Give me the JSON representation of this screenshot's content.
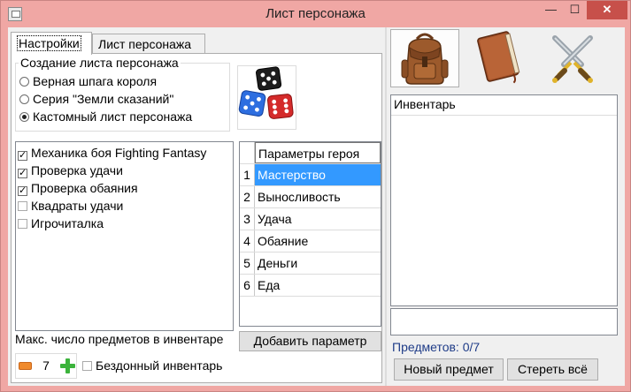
{
  "window": {
    "title": "Лист персонажа",
    "minimize_glyph": "—",
    "maximize_glyph": "☐",
    "close_glyph": "✕",
    "accent_color": "#f0a7a4",
    "close_color": "#c7504a"
  },
  "tabs": [
    {
      "label": "Настройки",
      "active": true
    },
    {
      "label": "Лист персонажа",
      "active": false
    }
  ],
  "creation": {
    "title": "Создание листа персонажа",
    "options": [
      {
        "label": "Верная шпага короля",
        "checked": false
      },
      {
        "label": "Серия \"Земли сказаний\"",
        "checked": false
      },
      {
        "label": "Кастомный лист персонажа",
        "checked": true
      }
    ],
    "image_icon": "dice-icon"
  },
  "mechanics": [
    {
      "label": "Механика боя Fighting Fantasy",
      "checked": true
    },
    {
      "label": "Проверка удачи",
      "checked": true
    },
    {
      "label": "Проверка обаяния",
      "checked": true
    },
    {
      "label": "Квадраты удачи",
      "checked": false
    },
    {
      "label": "Игрочиталка",
      "checked": false
    }
  ],
  "params_grid": {
    "header": "Параметры героя",
    "rows": [
      {
        "num": "1",
        "name": "Мастерство",
        "selected": true
      },
      {
        "num": "2",
        "name": "Выносливость",
        "selected": false
      },
      {
        "num": "3",
        "name": "Удача",
        "selected": false
      },
      {
        "num": "4",
        "name": "Обаяние",
        "selected": false
      },
      {
        "num": "5",
        "name": "Деньги",
        "selected": false
      },
      {
        "num": "6",
        "name": "Еда",
        "selected": false
      }
    ],
    "selection_color": "#3399ff"
  },
  "add_param_label": "Добавить параметр",
  "inventory_settings": {
    "max_label": "Макс. число предметов в инвентаре",
    "max_value": "7",
    "bottomless_label": "Бездонный инвентарь",
    "bottomless_checked": false
  },
  "right_toolbar": [
    {
      "icon": "backpack-icon",
      "active": true
    },
    {
      "icon": "book-icon",
      "active": false
    },
    {
      "icon": "crossed-swords-icon",
      "active": false
    }
  ],
  "inventory": {
    "header": "Инвентарь",
    "count_label": "Предметов: 0/7",
    "count_color": "#1f3c88",
    "new_item_label": "Новый предмет",
    "clear_all_label": "Стереть всё"
  }
}
